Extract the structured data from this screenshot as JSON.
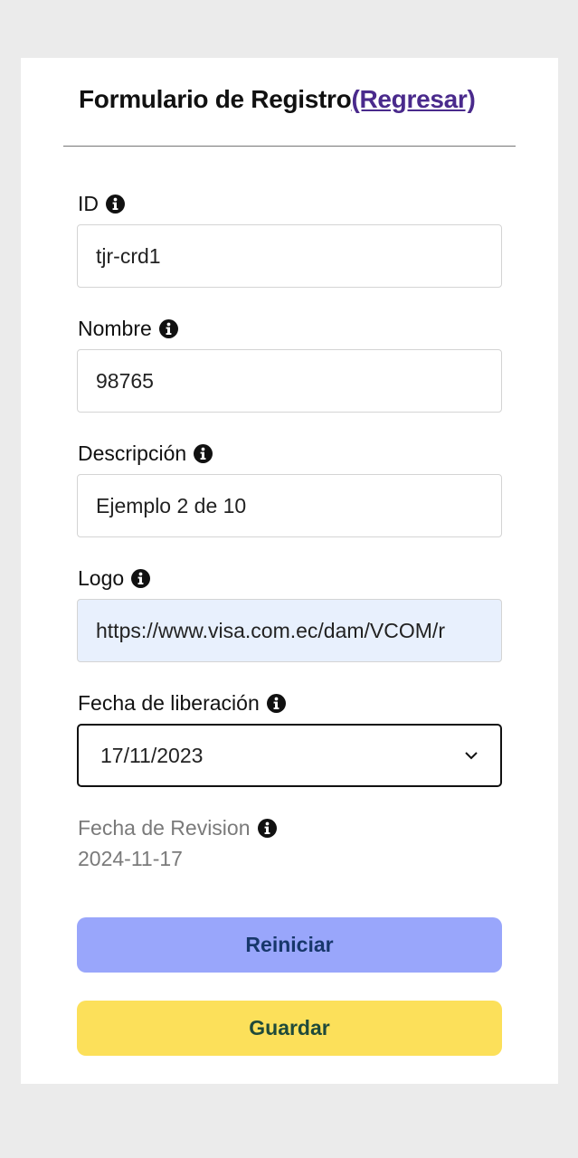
{
  "header": {
    "title": "Formulario de Registro",
    "back_link": "(Regresar)"
  },
  "fields": {
    "id": {
      "label": "ID",
      "value": "tjr-crd1"
    },
    "nombre": {
      "label": "Nombre",
      "value": "98765"
    },
    "descripcion": {
      "label": "Descripción",
      "value": "Ejemplo 2 de 10"
    },
    "logo": {
      "label": "Logo",
      "value": "https://www.visa.com.ec/dam/VCOM/r"
    },
    "fecha_liberacion": {
      "label": "Fecha de liberación",
      "selected": "17/11/2023"
    },
    "fecha_revision": {
      "label": "Fecha de Revision",
      "value": "2024-11-17"
    }
  },
  "buttons": {
    "reset": "Reiniciar",
    "save": "Guardar"
  },
  "icons": {
    "info": "info-circle-icon",
    "chevron": "chevron-down-icon"
  },
  "colors": {
    "link": "#4a2a8c",
    "reset_bg": "#99a6fb",
    "save_bg": "#fce05a",
    "autofill_bg": "#e8f0fd"
  }
}
